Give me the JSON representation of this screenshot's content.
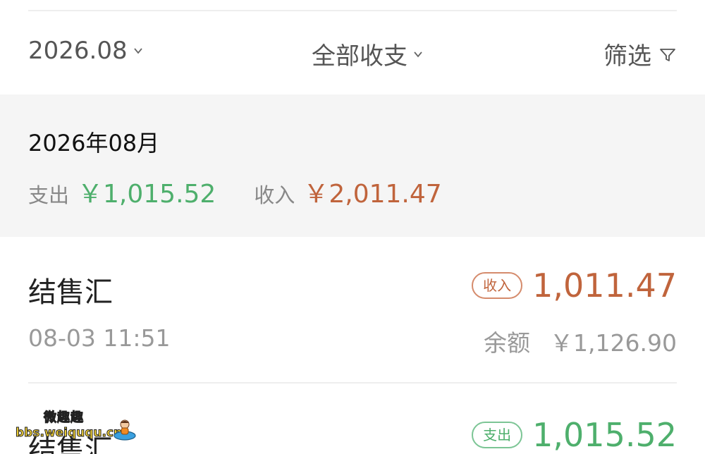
{
  "filter_bar": {
    "month": "2026.08",
    "type": "全部收支",
    "screen": "筛选"
  },
  "month_summary": {
    "title": "2026年08月",
    "expense_label": "支出",
    "expense_value": "￥1,015.52",
    "income_label": "收入",
    "income_value": "￥2,011.47"
  },
  "transactions": [
    {
      "name": "结售汇",
      "time": "08-03 11:51",
      "badge": "收入",
      "amount": "1,011.47",
      "balance_label": "余额",
      "balance_value": "￥1,126.90"
    },
    {
      "name": "结售汇",
      "badge": "支出",
      "amount": "1,015.52"
    }
  ],
  "watermark": {
    "title": "微趣趣",
    "url": "bbs.weiququ.cn"
  },
  "colors": {
    "expense": "#4eaf6c",
    "income": "#c0643c",
    "band": "#f5f5f5"
  },
  "icons": {
    "month_chevron": "chevron-down-icon",
    "type_chevron": "chevron-down-icon",
    "screen": "filter-funnel-icon"
  }
}
